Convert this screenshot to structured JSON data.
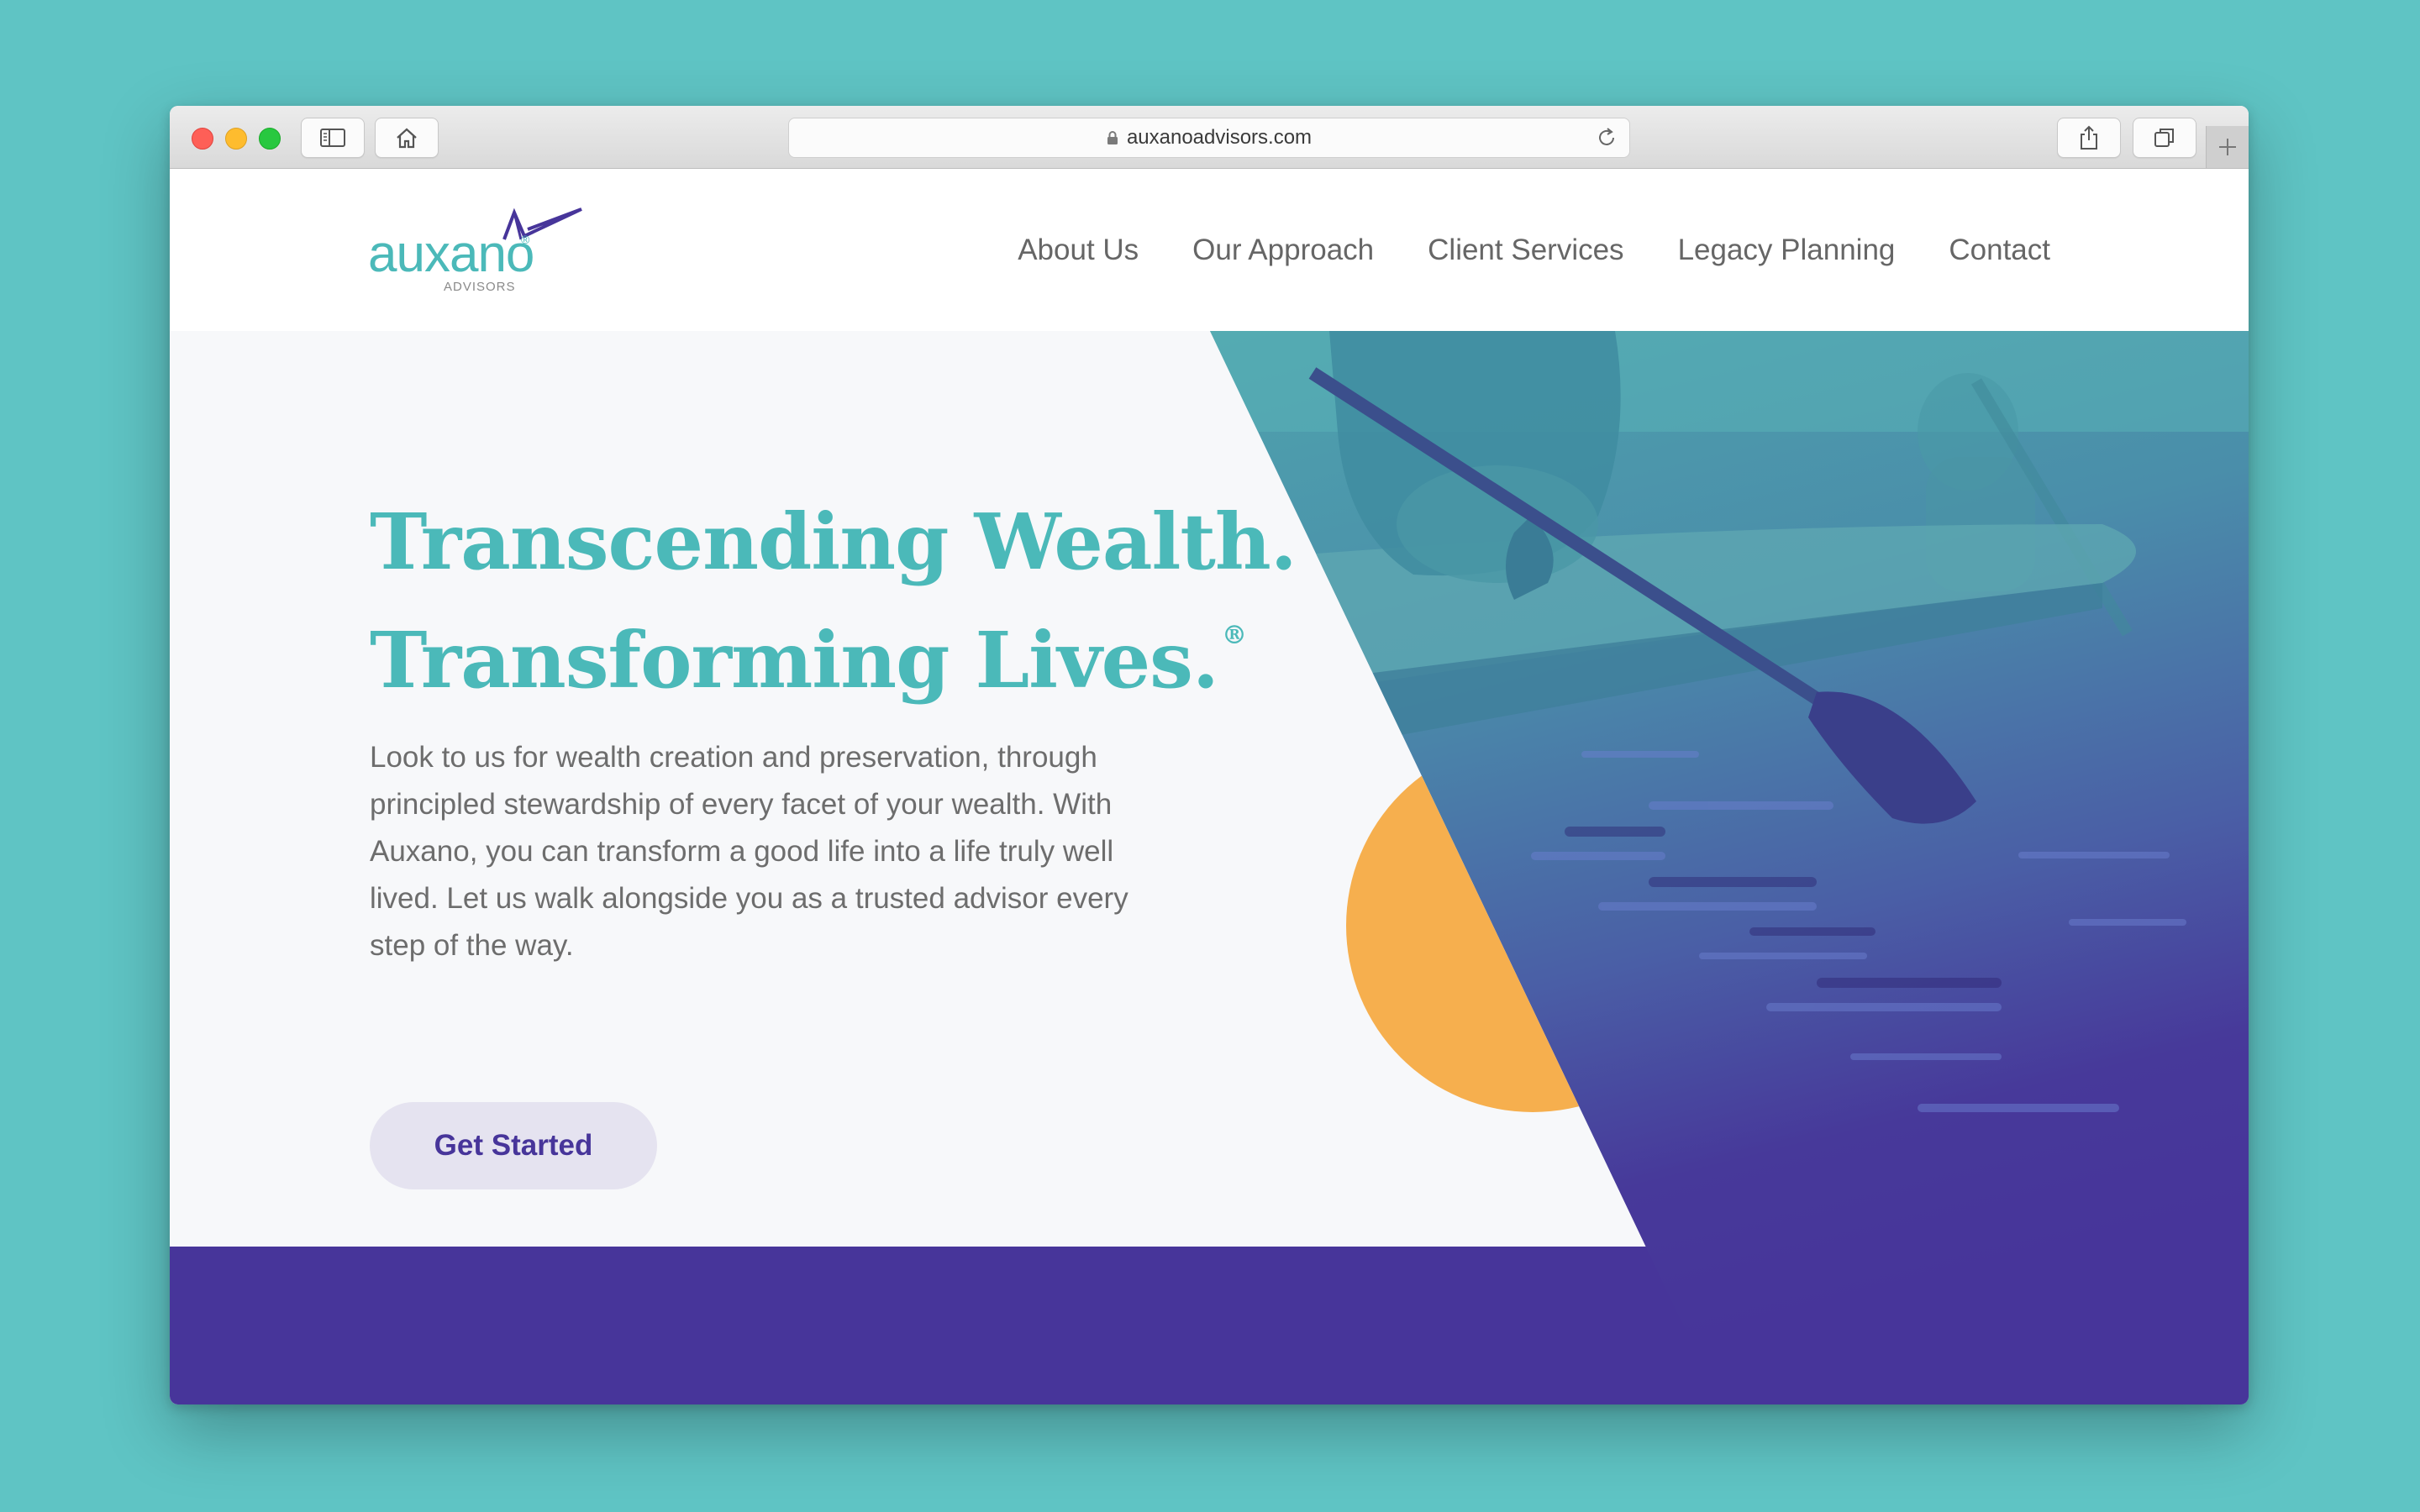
{
  "browser": {
    "url": "auxanoadvisors.com"
  },
  "logo": {
    "wordmark": "auxano",
    "registered": "®",
    "tagline": "ADVISORS"
  },
  "nav": {
    "items": [
      {
        "label": "About Us"
      },
      {
        "label": "Our Approach"
      },
      {
        "label": "Client Services"
      },
      {
        "label": "Legacy Planning"
      },
      {
        "label": "Contact"
      }
    ]
  },
  "hero": {
    "headline_line1": "Transcending Wealth.",
    "headline_line2": "Transforming Lives.",
    "registered_mark": "®",
    "body": "Look to us for wealth creation and preservation, through principled stewardship of every facet of your wealth. With Auxano, you can transform a good life into a life truly well lived. Let us walk alongside you as a trusted advisor every step of the way.",
    "cta_label": "Get Started"
  },
  "colors": {
    "teal": "#4bb9b9",
    "purple": "#47359a",
    "orange": "#f6af4e",
    "background": "#5fc4c4"
  },
  "icons": {
    "sidebar": "sidebar-icon",
    "home": "home-icon",
    "lock": "lock-icon",
    "reload": "reload-icon",
    "share": "share-icon",
    "tabs": "tabs-icon",
    "new_tab": "plus-icon"
  }
}
